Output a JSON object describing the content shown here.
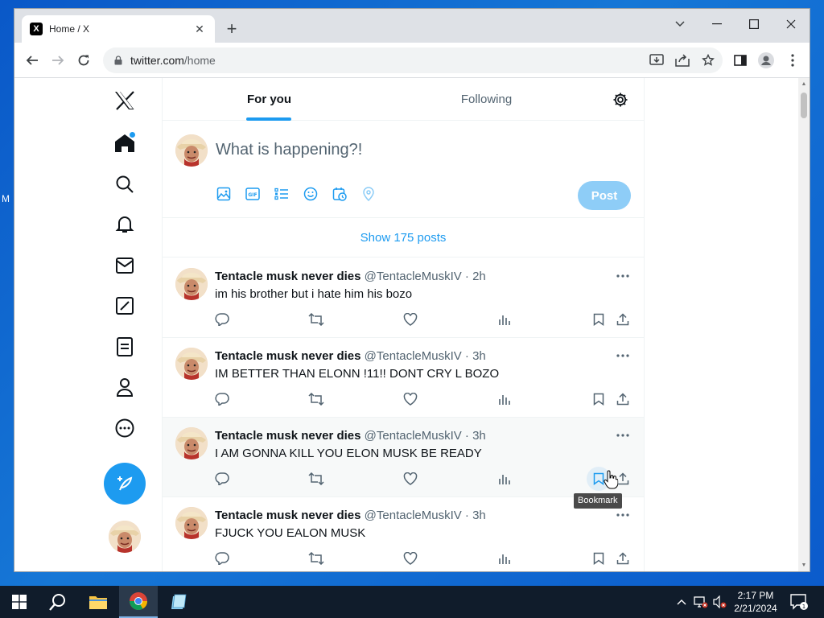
{
  "desktop": {
    "fragment_text": "M"
  },
  "browser": {
    "tab_title": "Home / X",
    "tab_favicon": "X",
    "new_tab_label": "+",
    "url_host": "twitter.com",
    "url_path": "/home"
  },
  "x": {
    "tabs": [
      {
        "label": "For you",
        "selected": true
      },
      {
        "label": "Following",
        "selected": false
      }
    ],
    "composer": {
      "placeholder": "What is happening?!",
      "post_label": "Post",
      "icons": [
        "image-icon",
        "gif-icon",
        "poll-icon",
        "emoji-icon",
        "schedule-icon",
        "location-icon"
      ]
    },
    "show_posts": "Show 175 posts",
    "nav_icons": [
      "x-logo-icon",
      "home-icon",
      "search-icon",
      "notifications-icon",
      "messages-icon",
      "grok-icon",
      "lists-icon",
      "profile-icon",
      "more-icon"
    ],
    "posts": [
      {
        "name": "Tentacle musk never dies",
        "meta": "@TentacleMuskIV · 2h",
        "text": "im his brother but i hate him his bozo"
      },
      {
        "name": "Tentacle musk never dies",
        "meta": "@TentacleMuskIV · 3h",
        "text": "IM BETTER THAN ELONN !11!! DONT CRY L BOZO"
      },
      {
        "name": "Tentacle musk never dies",
        "meta": "@TentacleMuskIV · 3h",
        "text": "I AM GONNA KILL YOU ELON MUSK BE READY"
      },
      {
        "name": "Tentacle musk never dies",
        "meta": "@TentacleMuskIV · 3h",
        "text": "FJUCK YOU EALON MUSK"
      }
    ],
    "tooltip": "Bookmark"
  },
  "taskbar": {
    "time": "2:17 PM",
    "date": "2/21/2024",
    "notification_count": "1"
  },
  "colors": {
    "accent": "#1d9bf0",
    "post_disabled": "#8ecdf7",
    "desktop": "#0b5bcc",
    "taskbar": "#101c2b"
  }
}
